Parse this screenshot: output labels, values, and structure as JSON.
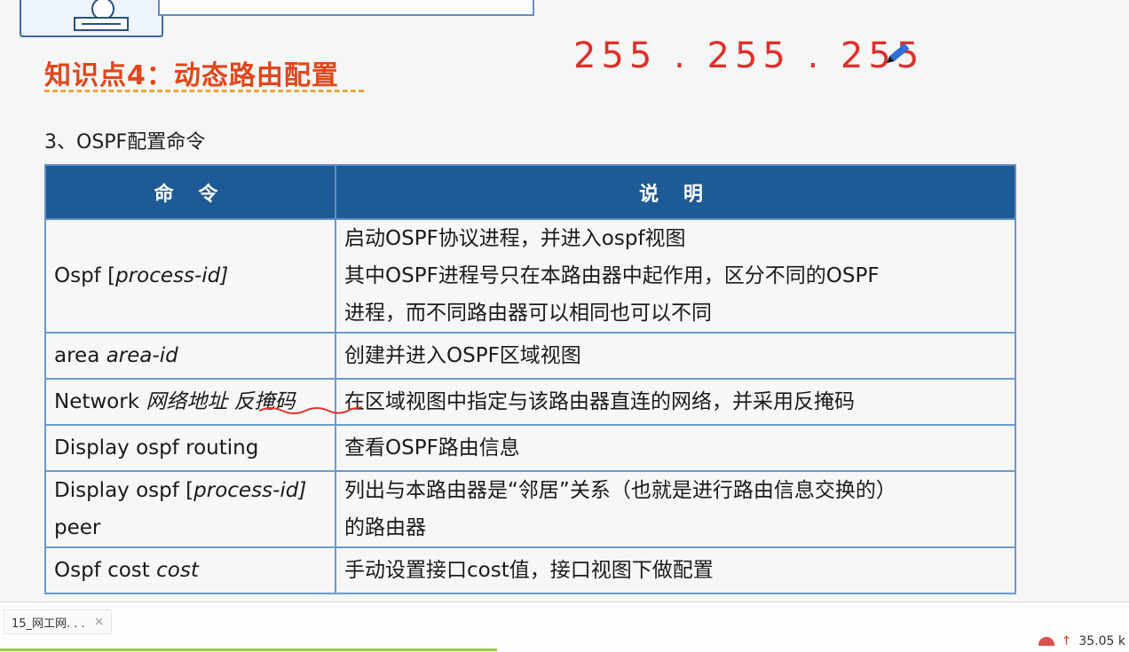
{
  "slide": {
    "title": "知识点4：动态路由配置",
    "subtitle": "3、OSPF配置命令",
    "handwriting": "255 . 255 . 255 .",
    "table": {
      "headers": [
        "命 令",
        "说 明"
      ],
      "rows": [
        {
          "cmd_plain": "Ospf  [",
          "cmd_italic": "process-id]",
          "desc_lines": [
            "启动OSPF协议进程，并进入ospf视图",
            "其中OSPF进程号只在本路由器中起作用，区分不同的OSPF",
            "进程，而不同路由器可以相同也可以不同"
          ]
        },
        {
          "cmd_plain": "area ",
          "cmd_italic": "area-id",
          "desc_lines": [
            "创建并进入OSPF区域视图"
          ]
        },
        {
          "cmd_plain": "Network ",
          "cmd_italic": "网络地址 反掩码",
          "desc_lines": [
            "在区域视图中指定与该路由器直连的网络，并采用反掩码"
          ]
        },
        {
          "cmd_plain": "Display ospf routing",
          "cmd_italic": "",
          "desc_lines": [
            "查看OSPF路由信息"
          ]
        },
        {
          "cmd_plain": "Display ospf  [",
          "cmd_italic": "process-id]",
          "cmd_line2": "peer",
          "desc_lines": [
            "列出与本路由器是“邻居”关系（也就是进行路由信息交换的）",
            "的路由器"
          ]
        },
        {
          "cmd_plain": "Ospf cost ",
          "cmd_italic": "cost",
          "desc_lines": [
            "手动设置接口cost值，接口视图下做配置"
          ]
        }
      ]
    }
  },
  "taskbar": {
    "tab_label": "15_网工网. . .",
    "close_glyph": "×",
    "speed": "35.05 k",
    "speed_arrow": "↑"
  },
  "colors": {
    "title": "#e2461b",
    "header_bg": "#1e5a95",
    "border": "#6a9ad0",
    "handwriting": "#e0302a"
  }
}
